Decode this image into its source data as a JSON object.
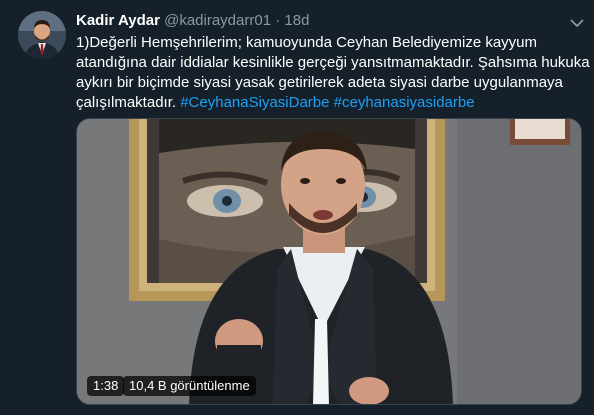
{
  "tweet": {
    "author_name": "Kadir Aydar",
    "handle": "@kadiraydarr01",
    "separator": "·",
    "time": "18d",
    "text_lines": [
      "1)Değerli Hemşehrilerim; kamuoyunda Ceyhan Belediyemize kayyum",
      "atandığına dair iddialar kesinlikle gerçeği yansıtmamaktadır. Şahsıma hukuka",
      "aykırı bir biçimde siyasi yasak getirilerek adeta siyasi darbe uygulanmaya",
      "çalışılmaktadır."
    ],
    "hashtags": [
      "#CeyhanaSiyasiDarbe",
      "#ceyhanasiyasidarbe"
    ]
  },
  "video": {
    "duration": "1:38",
    "views": "10,4 B görüntülenme"
  },
  "icons": {
    "menu": "chevron-down-icon",
    "avatar": "profile-photo"
  },
  "colors": {
    "background": "#15202b",
    "text": "#ffffff",
    "secondary_text": "#8899a6",
    "hashtag": "#1da1f2"
  }
}
